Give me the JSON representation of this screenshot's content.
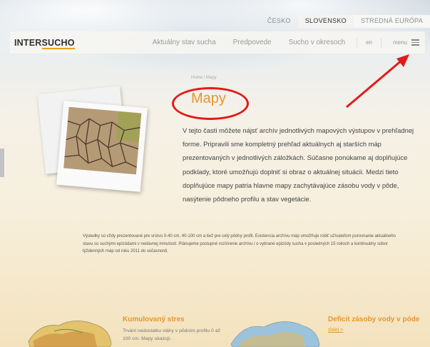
{
  "langs": [
    "ČESKO",
    "SLOVENSKO",
    "STREDNÁ EURÓPA"
  ],
  "logo": {
    "part1": "INTER",
    "part2": "SUCHO"
  },
  "nav": {
    "links": [
      "Aktuálny stav sucha",
      "Predpovede",
      "Sucho v okresoch"
    ],
    "lang": "en",
    "menu": "menu"
  },
  "breadcrumb": "Home / Mapy",
  "title": "Mapy",
  "intro": "V tejto časti môžete nájsť archív jednotlivých mapových výstupov v prehľadnej forme. Pripravili sme kompletný prehľad aktuálnych aj starších máp prezentovaných v jednotlivých záložkách. Súčasne ponúkame aj doplňujúce podklady, ktoré umožňujú doplniť si obraz o aktuálnej situácii. Medzi tieto doplňujúce mapy patria hlavne mapy zachytávajúce zásobu vody v pôde, nasýtenie pôdneho profilu a stav vegetácie.",
  "note": "Výsledky sú vždy prezentované pre vrstvu 0-40 cm, 40-100 cm a tiež pre celý pôdny profil. Existencia archívu máp umožňuje robiť užívateľom porovnanie aktuálneho stavu so suchými epizódami v nedávnej minulosti. Plánujeme postupné rozšírenie archívu i o vybrané epizódy sucha v posledných 15 rokoch a kontinuálny súbor týždenných máp od roku 2011 do súčasnosti.",
  "cards": [
    {
      "title": "Kumulovaný stres",
      "desc": "Trvání nedostatku vláhy v půdním profilu 0 až 100 cm. Mapy ukazují,"
    },
    {
      "title": "Deficit zásoby vody v póde",
      "link": "ďalej >"
    }
  ],
  "colors": {
    "accent": "#e8962c",
    "annotation": "#e21a1a"
  }
}
